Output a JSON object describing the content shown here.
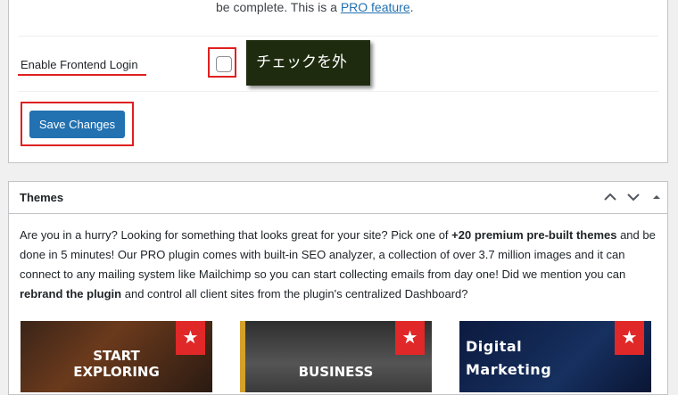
{
  "settings": {
    "pro_prefix": "be complete. This is a ",
    "pro_link": "PRO feature",
    "pro_suffix": ".",
    "frontend_login_label": "Enable Frontend Login",
    "frontend_login_checked": false,
    "callout": "チェックを外す！",
    "save_label": "Save Changes"
  },
  "themes": {
    "title": "Themes",
    "desc": {
      "p1": "Are you in a hurry? Looking for something that looks great for your site? Pick one of ",
      "b1": "+20 premium pre-built themes",
      "p2": " and be done in 5 minutes! Our PRO plugin comes with built-in SEO analyzer, a collection of over 3.7 million images and it can connect to any mailing system like Mailchimp so you can start collecting emails from day one! Did we mention you can ",
      "b2": "rebrand the plugin",
      "p3": " and control all client sites from the plugin's centralized Dashboard?"
    },
    "cards": [
      {
        "line1": "START",
        "line2": "EXPLORING",
        "icon": "star-icon"
      },
      {
        "line1": "BUSINESS",
        "icon": "star-icon"
      },
      {
        "line1": "Digital",
        "line2": "Marketing",
        "icon": "star-icon"
      }
    ]
  },
  "colors": {
    "accent": "#2271b1",
    "highlight": "#e02020",
    "callout_bg": "#1f2b0f",
    "badge": "#e02828"
  }
}
